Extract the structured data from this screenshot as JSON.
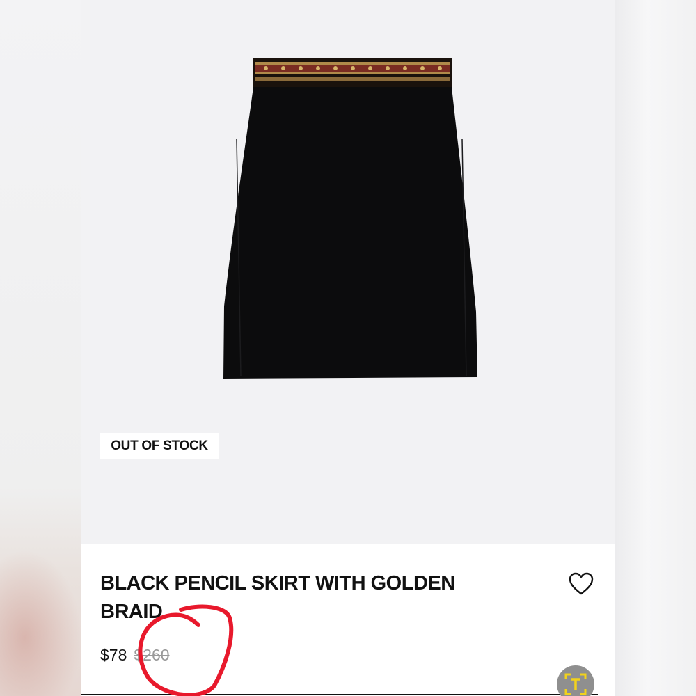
{
  "product": {
    "badge": "OUT OF STOCK",
    "title": "BLACK PENCIL SKIRT WITH GOLDEN BRAID",
    "price": "$78",
    "original_price": "$260"
  },
  "icons": {
    "favorite": "heart-outline-icon",
    "translate": "translate-text-icon"
  },
  "colors": {
    "annotation": "#e8192c",
    "badge_bg": "#ffffff",
    "strikethrough_price": "#9a9a9a",
    "fab_accent": "#f2d21b"
  }
}
